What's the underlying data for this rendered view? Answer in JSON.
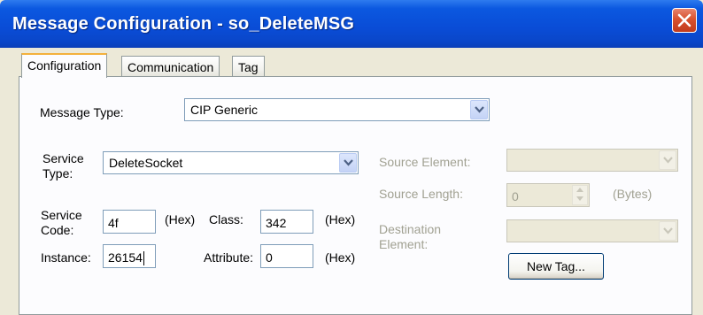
{
  "window": {
    "title": "Message Configuration - so_DeleteMSG",
    "close_label": "×"
  },
  "tabs": [
    {
      "label": "Configuration",
      "active": true
    },
    {
      "label": "Communication",
      "active": false
    },
    {
      "label": "Tag",
      "active": false
    }
  ],
  "form": {
    "message_type_label": "Message Type:",
    "message_type_value": "CIP Generic",
    "service_type_label_line1": "Service",
    "service_type_label_line2": "Type:",
    "service_type_value": "DeleteSocket",
    "service_code_label_line1": "Service",
    "service_code_label_line2": "Code:",
    "service_code_value": "4f",
    "hex_label": "(Hex)",
    "class_label": "Class:",
    "class_value": "342",
    "instance_label": "Instance:",
    "instance_value": "26154",
    "attribute_label": "Attribute:",
    "attribute_value": "0",
    "source_element_label": "Source Element:",
    "source_element_value": "",
    "source_length_label": "Source Length:",
    "source_length_value": "0",
    "bytes_label": "(Bytes)",
    "destination_label_line1": "Destination",
    "destination_label_line2": "Element:",
    "destination_value": "",
    "new_tag_button": "New Tag..."
  },
  "colors": {
    "titlebar": "#0A4CD6",
    "close_button": "#D8522F",
    "dialog_background": "#ECE9D8",
    "active_tab_highlight": "#F3B13C",
    "disabled_text": "#A1A192"
  }
}
